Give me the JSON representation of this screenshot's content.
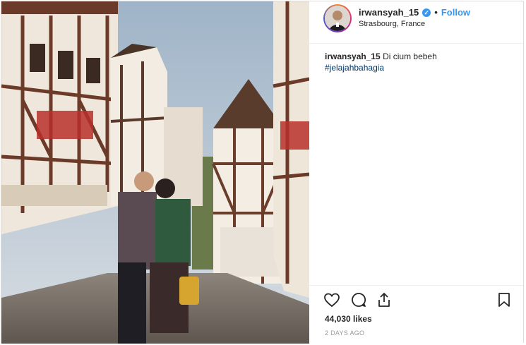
{
  "post": {
    "username": "irwansyah_15",
    "verified_icon": "verified-badge-icon",
    "separator": "•",
    "follow_label": "Follow",
    "location": "Strasbourg, France",
    "caption_text": "Di cium bebeh",
    "hashtag": "#jelajahbahagia",
    "likes": "44,030 likes",
    "timestamp": "2 DAYS AGO"
  },
  "icons": {
    "like": "heart-icon",
    "comment": "comment-bubble-icon",
    "share": "share-icon",
    "save": "bookmark-icon"
  },
  "colors": {
    "accent": "#3897f0",
    "hashtag": "#003569",
    "text": "#262626",
    "muted": "#999999",
    "border": "#efefef"
  }
}
